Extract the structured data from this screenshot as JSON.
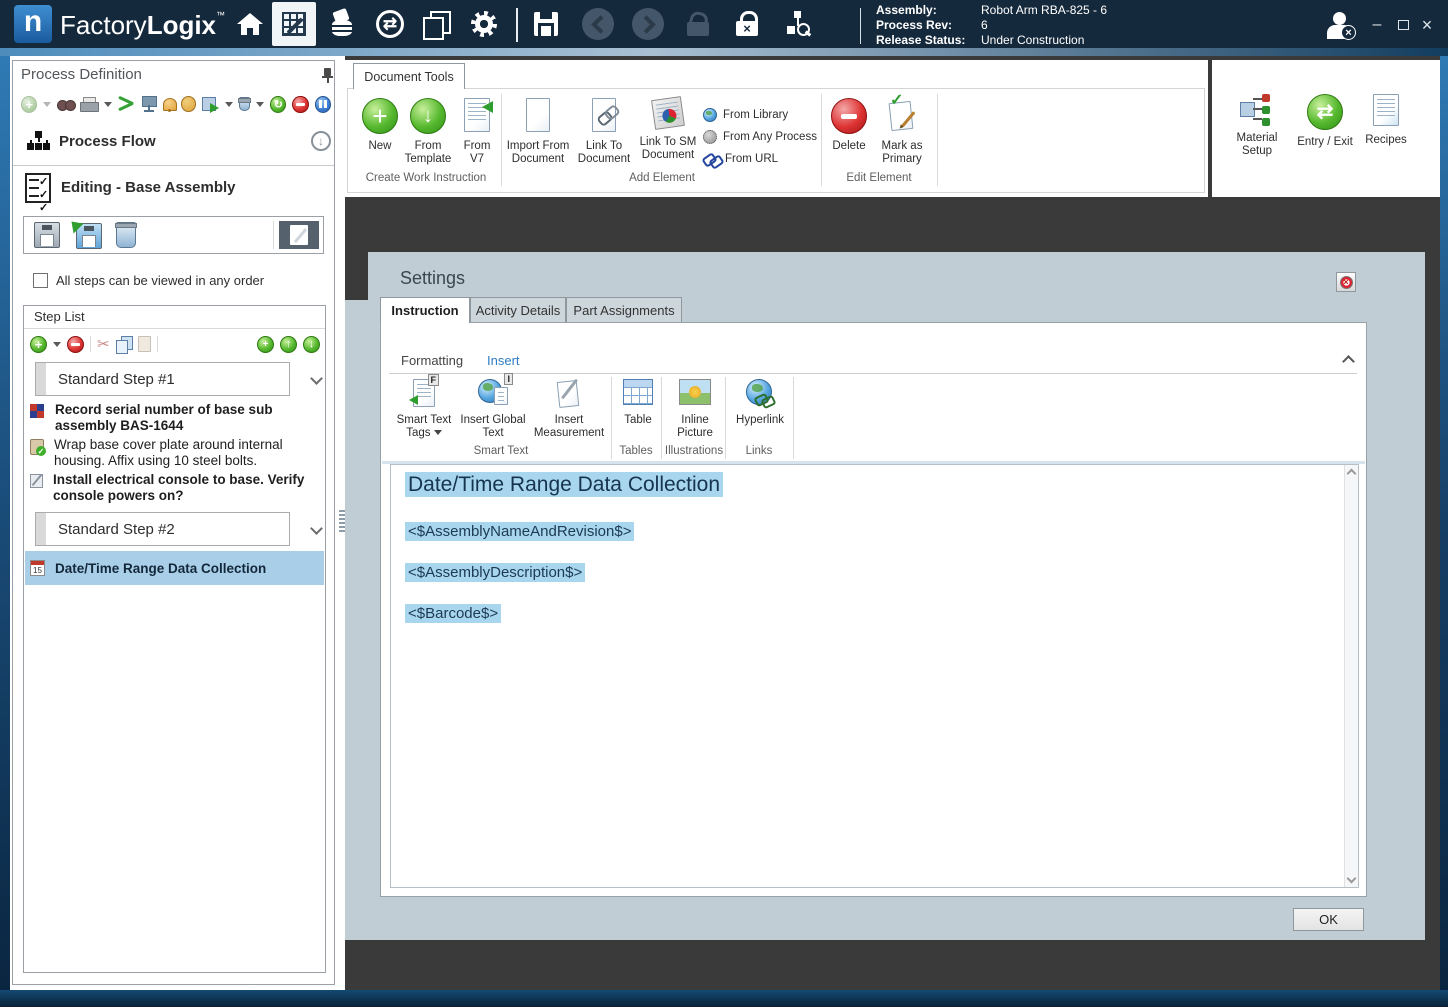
{
  "brand": {
    "logo_letter": "n",
    "name_light": "Factory",
    "name_bold": "Logix",
    "tm": "™"
  },
  "topbar": {
    "assembly_label": "Assembly:",
    "assembly_value": "Robot Arm RBA-825 - 6",
    "process_rev_label": "Process Rev:",
    "process_rev_value": "6",
    "release_label": "Release Status:",
    "release_value": "Under Construction"
  },
  "window_controls": {
    "minimize": "–",
    "close": "×"
  },
  "left_panel": {
    "title": "Process Definition",
    "process_flow": "Process Flow",
    "editing_title": "Editing - Base Assembly",
    "order_checkbox": "All steps can be viewed in any order",
    "step_list_title": "Step List",
    "calendar_day": "15",
    "steps": [
      {
        "label": "Standard Step #1"
      },
      {
        "label": "Standard Step #2"
      }
    ],
    "step1_items": [
      {
        "text": "Record serial number of base sub assembly BAS-1644"
      },
      {
        "text": "Wrap base cover plate around internal housing. Affix using 10 steel bolts."
      },
      {
        "text": "Install electrical console to base. Verify console powers on?"
      }
    ],
    "step2_items": [
      {
        "text": "Date/Time Range Data Collection"
      }
    ]
  },
  "ribbon": {
    "tab": "Document Tools",
    "new": "New",
    "from_template": "From Template",
    "from_v7": "From V7",
    "group_create": "Create Work Instruction",
    "import_from_document": "Import From Document",
    "link_to_document": "Link To Document",
    "link_to_sm_document": "Link To SM Document",
    "from_library": "From Library",
    "from_any_process": "From Any Process",
    "from_url": "From URL",
    "group_add": "Add Element",
    "delete": "Delete",
    "mark_as_primary": "Mark as Primary",
    "group_edit": "Edit Element"
  },
  "right_panel": {
    "material_setup": "Material Setup",
    "entry_exit": "Entry / Exit",
    "recipes": "Recipes"
  },
  "settings": {
    "title": "Settings",
    "tabs": [
      {
        "label": "Instruction"
      },
      {
        "label": "Activity Details"
      },
      {
        "label": "Part Assignments"
      }
    ],
    "editor_tab_formatting": "Formatting",
    "editor_tab_insert": "Insert",
    "smart_text_tags": "Smart Text Tags",
    "insert_global_text": "Insert Global Text",
    "insert_measurement": "Insert Measurement",
    "table": "Table",
    "inline_picture": "Inline Picture",
    "hyperlink": "Hyperlink",
    "badge_f": "F",
    "badge_i": "I",
    "group_smart_text": "Smart Text",
    "group_tables": "Tables",
    "group_illustrations": "Illustrations",
    "group_links": "Links",
    "doc_heading": "Date/Time Range Data Collection",
    "doc_tags": [
      {
        "text": "<$AssemblyNameAndRevision$>"
      },
      {
        "text": "<$AssemblyDescription$>"
      },
      {
        "text": "<$Barcode$>"
      }
    ],
    "ok": "OK"
  },
  "colors": {
    "topbar": "#15293c",
    "accent": "#2f7ab5",
    "selection": "#a9cfe8",
    "panel": "#c1cdd4",
    "highlight": "#a7d6ee",
    "dark_bg": "#3a3a3a",
    "insert_tab": "#2e7cc3"
  }
}
